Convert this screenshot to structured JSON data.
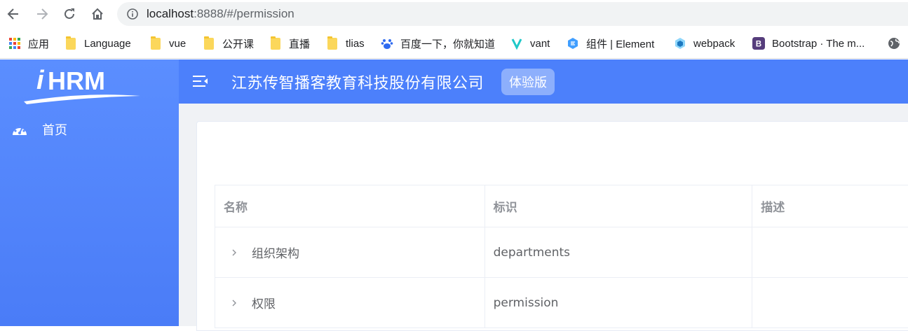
{
  "browser": {
    "url_host": "localhost",
    "url_path": ":8888/#/permission"
  },
  "bookmarks": [
    {
      "icon": "apps-grid-icon",
      "label": "应用"
    },
    {
      "icon": "folder-icon",
      "label": "Language"
    },
    {
      "icon": "folder-icon",
      "label": "vue"
    },
    {
      "icon": "folder-icon",
      "label": "公开课"
    },
    {
      "icon": "folder-icon",
      "label": "直播"
    },
    {
      "icon": "folder-icon",
      "label": "tlias"
    },
    {
      "icon": "baidu-paw-icon",
      "label": "百度一下，你就知道"
    },
    {
      "icon": "vant-logo-icon",
      "label": "vant"
    },
    {
      "icon": "element-logo-icon",
      "label": "组件 | Element"
    },
    {
      "icon": "webpack-cube-icon",
      "label": "webpack"
    },
    {
      "icon": "bootstrap-logo-icon",
      "label": "Bootstrap · The m..."
    }
  ],
  "sidebar": {
    "logo_text": "iHRM",
    "items": [
      {
        "icon": "dashboard-icon",
        "label": "首页"
      }
    ]
  },
  "header": {
    "company": "江苏传智播客教育科技股份有限公司",
    "badge": "体验版"
  },
  "table": {
    "columns": [
      "名称",
      "标识",
      "描述"
    ],
    "rows": [
      {
        "name": "组织架构",
        "code": "departments",
        "description": ""
      },
      {
        "name": "权限",
        "code": "permission",
        "description": ""
      }
    ]
  },
  "colors": {
    "sidebar": "#5b8eff",
    "header": "#4c80fb",
    "badge": "#8daffc"
  }
}
